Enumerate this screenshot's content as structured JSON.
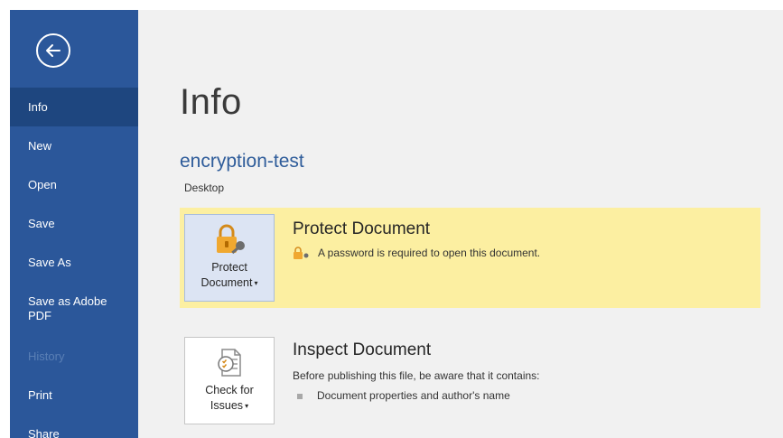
{
  "backstage": {
    "nav": {
      "back_label": "Back",
      "items": [
        {
          "label": "Info",
          "active": true,
          "enabled": true
        },
        {
          "label": "New",
          "active": false,
          "enabled": true
        },
        {
          "label": "Open",
          "active": false,
          "enabled": true
        },
        {
          "label": "Save",
          "active": false,
          "enabled": true
        },
        {
          "label": "Save As",
          "active": false,
          "enabled": true
        },
        {
          "label": "Save as Adobe PDF",
          "active": false,
          "enabled": true
        },
        {
          "label": "History",
          "active": false,
          "enabled": false
        },
        {
          "label": "Print",
          "active": false,
          "enabled": true
        },
        {
          "label": "Share",
          "active": false,
          "enabled": true
        }
      ]
    }
  },
  "info": {
    "title": "Info",
    "document_name": "encryption-test",
    "location": "Desktop",
    "protect": {
      "button_line1": "Protect",
      "button_line2": "Document",
      "title": "Protect Document",
      "status": "A password is required to open this document.",
      "highlight_color": "#fcefa1"
    },
    "inspect": {
      "button_line1": "Check for",
      "button_line2": "Issues",
      "title": "Inspect Document",
      "description": "Before publishing this file, be aware that it contains:",
      "bullets": [
        "Document properties and author's name"
      ]
    }
  },
  "colors": {
    "sidebar": "#2b579a",
    "sidebar_active": "#1e467f",
    "doc_name": "#2e5c9a"
  },
  "icons": {
    "back": "back-arrow-icon",
    "protect": "lock-key-icon",
    "inspect": "check-for-issues-icon"
  }
}
